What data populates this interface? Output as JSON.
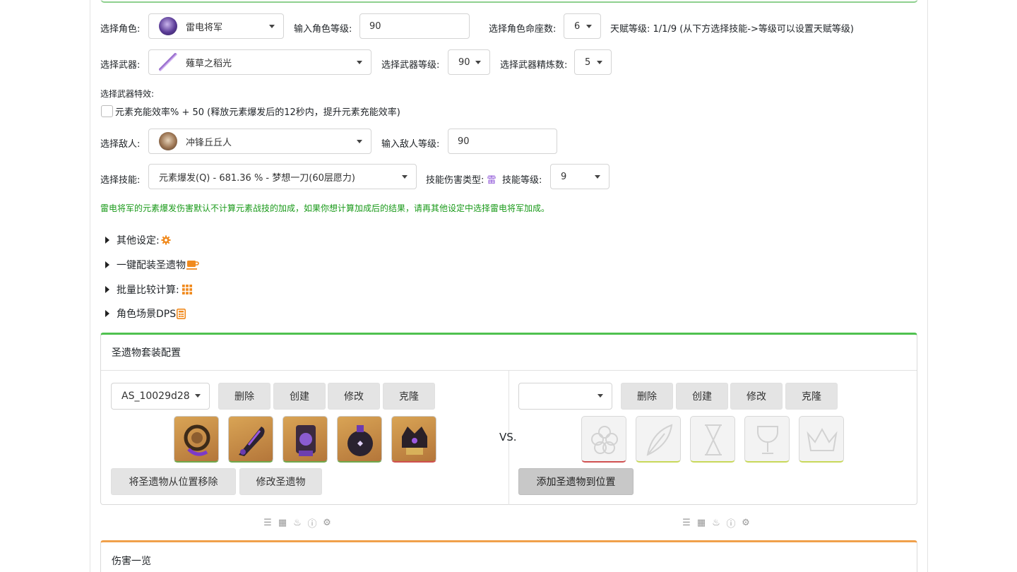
{
  "character": {
    "label": "选择角色:",
    "selected": "雷电将军",
    "level_label": "输入角色等级:",
    "level": "90",
    "constellation_label": "选择角色命座数:",
    "constellation": "6",
    "talent_text": "天赋等级: 1/1/9 (从下方选择技能->等级可以设置天赋等级)"
  },
  "weapon": {
    "label": "选择武器:",
    "selected": "薙草之稻光",
    "level_label": "选择武器等级:",
    "level": "90",
    "refine_label": "选择武器精炼数:",
    "refine": "5",
    "effect_label": "选择武器特效:",
    "effect_option": "元素充能效率% + 50 (释放元素爆发后的12秒内，提升元素充能效率)"
  },
  "enemy": {
    "label": "选择敌人:",
    "selected": "冲锋丘丘人",
    "level_label": "输入敌人等级:",
    "level": "90"
  },
  "skill": {
    "label": "选择技能:",
    "selected": "元素爆发(Q) - 681.36 % - 梦想一刀(60层愿力)",
    "damage_type_label": "技能伤害类型:",
    "damage_type": "雷",
    "level_label": "技能等级:",
    "level": "9"
  },
  "note": "雷电将军的元素爆发伤害默认不计算元素战技的加成，如果你想计算加成后的结果，请再其他设定中选择雷电将军加成。",
  "sections": [
    {
      "label": "其他设定:",
      "icon": "gear-icon"
    },
    {
      "label": "一键配装圣遗物",
      "icon": "coffee-icon"
    },
    {
      "label": "批量比较计算:",
      "icon": "grid-icon"
    },
    {
      "label": "角色场景DPS",
      "icon": "calculator-icon"
    }
  ],
  "artifact_card": {
    "title": "圣遗物套装配置",
    "left": {
      "set_selected": "AS_10029d28",
      "buttons": [
        "删除",
        "创建",
        "修改",
        "克隆"
      ],
      "remove_button": "将圣遗物从位置移除",
      "edit_button": "修改圣遗物"
    },
    "vs": "VS.",
    "right": {
      "set_selected": "",
      "buttons": [
        "删除",
        "创建",
        "修改",
        "克隆"
      ],
      "add_button": "添加圣遗物到位置"
    }
  },
  "damage_card": {
    "title": "伤害一览"
  },
  "colors": {
    "accent_green": "#4fc14f",
    "accent_orange": "#f0a04b",
    "note_green": "#1a9a1a",
    "electro": "#8a4fd6",
    "icon_orange": "#f08a1e"
  }
}
